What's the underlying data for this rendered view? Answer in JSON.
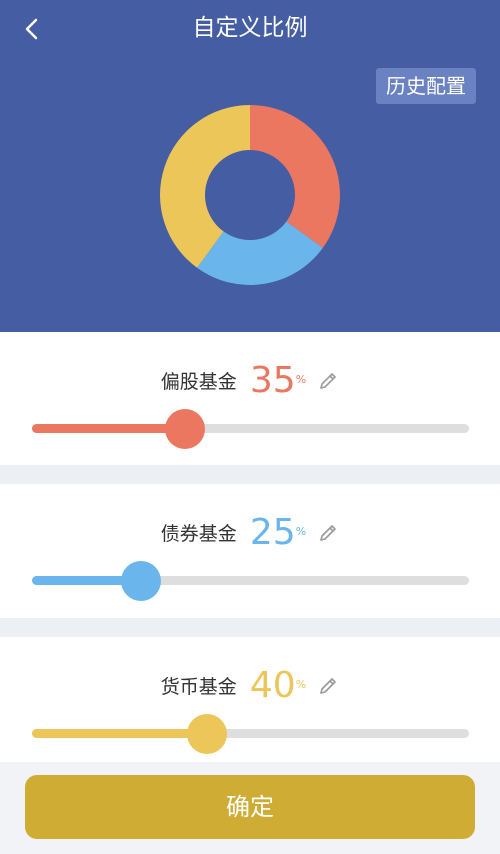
{
  "header": {
    "title": "自定义比例",
    "history_button": "历史配置",
    "bg_color": "#445da3"
  },
  "chart_data": {
    "type": "pie",
    "categories": [
      "偏股基金",
      "债券基金",
      "货币基金"
    ],
    "values": [
      35,
      25,
      40
    ],
    "colors": [
      "#ec7761",
      "#6ab5ec",
      "#ecc659"
    ]
  },
  "funds": [
    {
      "name": "偏股基金",
      "value": "35",
      "unit": "%",
      "fraction": 0.35,
      "color": "#ec7761"
    },
    {
      "name": "债券基金",
      "value": "25",
      "unit": "%",
      "fraction": 0.25,
      "color": "#6ab5ec"
    },
    {
      "name": "货币基金",
      "value": "40",
      "unit": "%",
      "fraction": 0.4,
      "color": "#ecc659"
    }
  ],
  "footer": {
    "confirm_label": "确定",
    "confirm_color": "#cfad35"
  },
  "icons": {
    "back": "back-arrow-icon",
    "edit": "pencil-icon"
  }
}
